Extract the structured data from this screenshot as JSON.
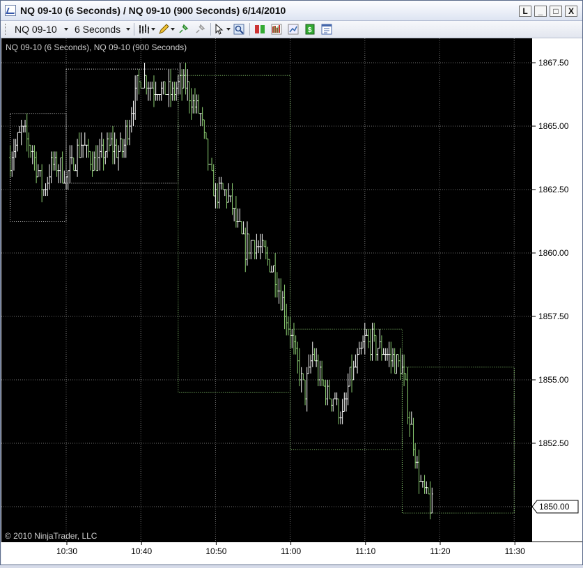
{
  "window": {
    "title": "NQ 09-10 (6 Seconds) / NQ 09-10 (900 Seconds)  6/14/2010",
    "buttons": [
      "L",
      "_",
      "□",
      "X"
    ]
  },
  "toolbar": {
    "instrument": "NQ 09-10",
    "interval": "6 Seconds"
  },
  "chart": {
    "series_label": "NQ 09-10 (6 Seconds), NQ 09-10 (900 Seconds)",
    "copyright": "© 2010 NinjaTrader, LLC",
    "last_price_label": "1850.00"
  },
  "chart_data": {
    "type": "bar",
    "price_axis": {
      "range": [
        1849.0,
        1869.0
      ],
      "ticks": [
        "1867.50",
        "1865.00",
        "1862.50",
        "1860.00",
        "1857.50",
        "1855.00",
        "1852.50",
        "1850.00"
      ]
    },
    "time_axis": {
      "ticks": [
        "10:30",
        "10:40",
        "10:50",
        "11:00",
        "11:10",
        "11:20",
        "11:30"
      ]
    },
    "boxes_900s": [
      {
        "start": "10:22:30",
        "end": "10:30:00",
        "high": 1865.5,
        "low": 1861.25
      },
      {
        "start": "10:30:00",
        "end": "10:45:00",
        "high": 1867.25,
        "low": 1862.75
      },
      {
        "start": "10:45:00",
        "end": "11:00:00",
        "high": 1867.0,
        "low": 1854.5
      },
      {
        "start": "11:00:00",
        "end": "11:15:00",
        "high": 1857.0,
        "low": 1852.25
      },
      {
        "start": "11:15:00",
        "end": "11:30:00",
        "high": 1855.5,
        "low": 1849.75
      }
    ],
    "close_path_6s": [
      [
        "10:22:30",
        1863.75
      ],
      [
        "10:24:00",
        1864.75
      ],
      [
        "10:25:30",
        1864.0
      ],
      [
        "10:27:00",
        1862.5
      ],
      [
        "10:28:00",
        1863.5
      ],
      [
        "10:29:30",
        1863.25
      ],
      [
        "10:30:00",
        1863.0
      ],
      [
        "10:32:00",
        1864.25
      ],
      [
        "10:34:00",
        1863.5
      ],
      [
        "10:36:00",
        1864.25
      ],
      [
        "10:37:30",
        1864.0
      ],
      [
        "10:39:00",
        1866.0
      ],
      [
        "10:40:00",
        1867.0
      ],
      [
        "10:42:00",
        1866.5
      ],
      [
        "10:44:00",
        1866.25
      ],
      [
        "10:45:00",
        1866.5
      ],
      [
        "10:46:00",
        1866.75
      ],
      [
        "10:47:00",
        1866.0
      ],
      [
        "10:48:00",
        1865.5
      ],
      [
        "10:49:00",
        1863.5
      ],
      [
        "10:50:00",
        1862.25
      ],
      [
        "10:51:00",
        1862.5
      ],
      [
        "10:52:00",
        1862.0
      ],
      [
        "10:53:00",
        1861.0
      ],
      [
        "10:54:00",
        1860.25
      ],
      [
        "10:55:00",
        1860.5
      ],
      [
        "10:56:00",
        1860.25
      ],
      [
        "10:57:00",
        1859.75
      ],
      [
        "10:58:00",
        1859.25
      ],
      [
        "10:59:00",
        1858.0
      ],
      [
        "11:00:00",
        1857.0
      ],
      [
        "11:01:00",
        1855.5
      ],
      [
        "11:02:00",
        1854.5
      ],
      [
        "11:03:00",
        1856.0
      ],
      [
        "11:04:00",
        1855.0
      ],
      [
        "11:05:00",
        1854.5
      ],
      [
        "11:06:00",
        1854.25
      ],
      [
        "11:07:00",
        1853.5
      ],
      [
        "11:08:00",
        1855.0
      ],
      [
        "11:09:00",
        1855.75
      ],
      [
        "11:10:00",
        1856.5
      ],
      [
        "11:11:00",
        1856.5
      ],
      [
        "11:12:00",
        1856.25
      ],
      [
        "11:13:00",
        1856.0
      ],
      [
        "11:14:00",
        1855.75
      ],
      [
        "11:15:00",
        1855.5
      ],
      [
        "11:16:00",
        1853.5
      ],
      [
        "11:17:00",
        1851.5
      ],
      [
        "11:18:00",
        1850.5
      ],
      [
        "11:19:00",
        1850.0
      ]
    ]
  }
}
